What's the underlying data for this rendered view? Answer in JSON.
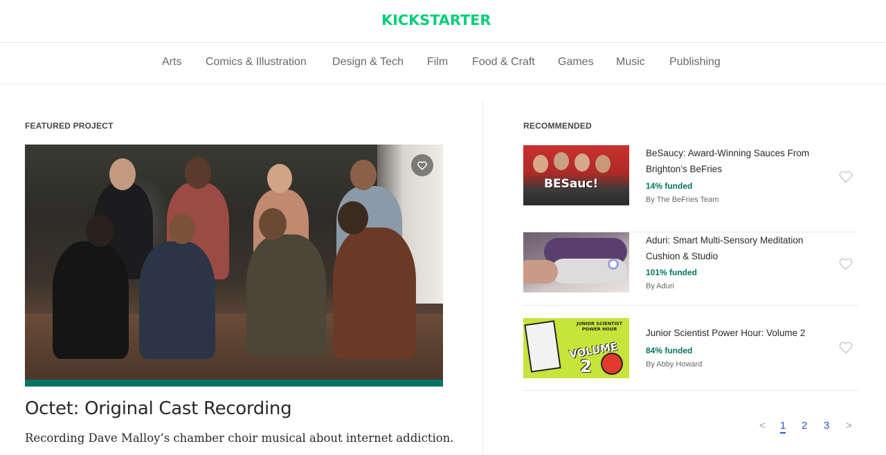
{
  "header": {
    "logo_text": "KICKSTARTER",
    "brand_color": "#05ce78"
  },
  "categories": [
    "Arts",
    "Comics & Illustration",
    "Design & Tech",
    "Film",
    "Food & Craft",
    "Games",
    "Music",
    "Publishing"
  ],
  "featured": {
    "section_label": "FEATURED PROJECT",
    "title": "Octet: Original Cast Recording",
    "blurb": "Recording Dave Malloy’s chamber choir musical about internet addiction.",
    "funded_fraction": 1.0,
    "bar_color": "#037362"
  },
  "recommended": {
    "section_label": "RECOMMENDED",
    "items": [
      {
        "title": "BeSaucy: Award-Winning Sauces From Brighton’s BeFries",
        "funded": "14% funded",
        "by": "By The BeFries Team",
        "thumb_text": "BESauc!"
      },
      {
        "title": "Aduri: Smart Multi-Sensory Meditation Cushion & Studio",
        "funded": "101% funded",
        "by": "By Aduri"
      },
      {
        "title": "Junior Scientist Power Hour: Volume 2",
        "funded": "84% funded",
        "by": "By Abby Howard",
        "thumb_text_top": "JUNIOR SCIENTIST POWER HOUR",
        "thumb_text_volume": "VOLUME",
        "thumb_text_num": "2"
      }
    ]
  },
  "pagination": {
    "prev": "<",
    "pages": [
      "1",
      "2",
      "3"
    ],
    "current": "1",
    "next": ">"
  },
  "icons": {
    "favorite": "heart-icon"
  }
}
